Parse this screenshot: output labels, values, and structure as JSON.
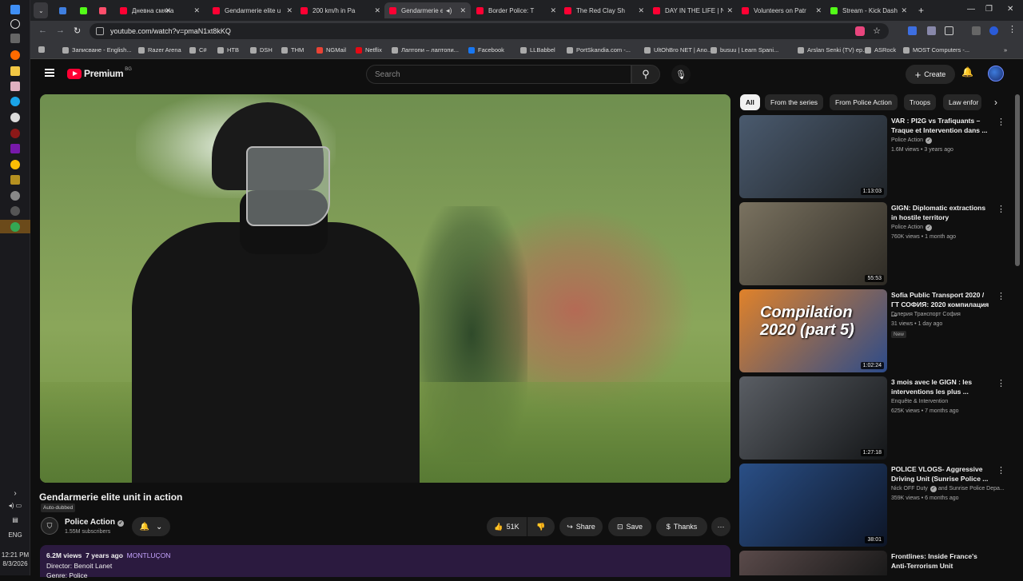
{
  "browser": {
    "tabs": [
      {
        "title": "",
        "color": "#ff4e6b"
      },
      {
        "title": "Дневна смяна",
        "color": "#ff0033"
      },
      {
        "title": "Gendarmerie elite u",
        "color": "#ff0033"
      },
      {
        "title": "200 km/h in Pa",
        "color": "#ff0033"
      },
      {
        "title": "Gendarmerie eli",
        "color": "#ff0033",
        "active": true
      },
      {
        "title": "Border Police: T",
        "color": "#ff0033"
      },
      {
        "title": "The Red Clay Sh",
        "color": "#ff0033"
      },
      {
        "title": "DAY IN THE LIFE | N",
        "color": "#ff0033"
      },
      {
        "title": "Volunteers on Patr",
        "color": "#ff0033"
      },
      {
        "title": "Stream - Kick Dashb",
        "color": "#53fc18"
      }
    ],
    "new_tab": "+",
    "url": "youtube.com/watch?v=pmaN1xt8kKQ",
    "bookmarks": [
      {
        "label": "Записване - English...",
        "color": "#aaa"
      },
      {
        "label": "Razer Arena",
        "color": "#aaa"
      },
      {
        "label": "C#",
        "color": "#aaa"
      },
      {
        "label": "HTB",
        "color": "#aaa"
      },
      {
        "label": "DSH",
        "color": "#aaa"
      },
      {
        "label": "THM",
        "color": "#aaa"
      },
      {
        "label": "NGMail",
        "color": "#ea4335"
      },
      {
        "label": "Netflix",
        "color": "#e50914"
      },
      {
        "label": "Лаптопи – лаптопи...",
        "color": "#aaa"
      },
      {
        "label": "Facebook",
        "color": "#1877f2"
      },
      {
        "label": "LLBabbel",
        "color": "#aaa"
      },
      {
        "label": "PortSkandia.com -...",
        "color": "#aaa"
      },
      {
        "label": "UltOhBro NET | Ano...",
        "color": "#aaa"
      },
      {
        "label": "busuu | Learn Spani...",
        "color": "#aaa"
      },
      {
        "label": "Arslan Senki (TV) ep...",
        "color": "#aaa"
      },
      {
        "label": "ASRock",
        "color": "#aaa"
      },
      {
        "label": "MOST Computers -...",
        "color": "#aaa"
      }
    ]
  },
  "youtube": {
    "logo_text": "Premium",
    "country_code": "BG",
    "search_placeholder": "Search",
    "create_label": "Create",
    "video": {
      "title": "Gendarmerie elite unit in action",
      "auto_dubbed": "Auto-dubbed",
      "channel": "Police Action",
      "subscribers": "1.55M subscribers",
      "likes": "51K",
      "share": "Share",
      "save": "Save",
      "thanks": "Thanks",
      "views": "6.2M views",
      "age": "7 years ago",
      "location": "MONTLUÇON",
      "director": "Director: Benoit Lanet",
      "genre": "Genre: Police"
    },
    "chips": [
      "All",
      "From the series",
      "From Police Action",
      "Troops",
      "Law enfor"
    ],
    "recommendations": [
      {
        "title": "VAR : PI2G vs Trafiquants – Traque et Intervention dans ...",
        "channel": "Police Action",
        "verified": true,
        "meta": "1.6M views • 3 years ago",
        "duration": "1:13:03",
        "colors": [
          "#4a5a6e",
          "#202428"
        ]
      },
      {
        "title": "GIGN: Diplomatic extractions in hostile territory",
        "channel": "Police Action",
        "verified": true,
        "meta": "760K views • 1 month ago",
        "duration": "55:53",
        "colors": [
          "#7a7260",
          "#2d2a24"
        ]
      },
      {
        "title": "Sofia Public Transport 2020 / ГТ СОФИЯ: 2020 компилация ...",
        "channel": "Галерия Транспорт София",
        "verified": false,
        "meta": "31 views • 1 day ago",
        "badge": "New",
        "duration": "1:02:24",
        "thumb_text": "Compilation 2020 (part 5)",
        "colors": [
          "#e0822a",
          "#2c4b8a"
        ]
      },
      {
        "title": "3 mois avec le GIGN : les interventions les plus ...",
        "channel": "Enquête & Intervention",
        "verified": false,
        "meta": "625K views • 7 months ago",
        "duration": "1:27:18",
        "colors": [
          "#5a5e64",
          "#141618"
        ]
      },
      {
        "title": "POLICE VLOGS- Aggressive Driving Unit (Sunrise Police ...",
        "channel": "Nick OFF Duty",
        "verified": true,
        "channel_extra": "and Sunrise Police Depa...",
        "meta": "359K views • 6 months ago",
        "duration": "38:01",
        "colors": [
          "#2a4f86",
          "#0d1526"
        ]
      },
      {
        "title": "Frontlines: Inside France's Anti-Terrorism Unit",
        "channel": "",
        "verified": false,
        "meta": "",
        "duration": "",
        "colors": [
          "#5a4a4a",
          "#1a1a1a"
        ]
      }
    ]
  },
  "system": {
    "language": "ENG",
    "time": "12:21 PM",
    "date": "8/3/2026"
  }
}
